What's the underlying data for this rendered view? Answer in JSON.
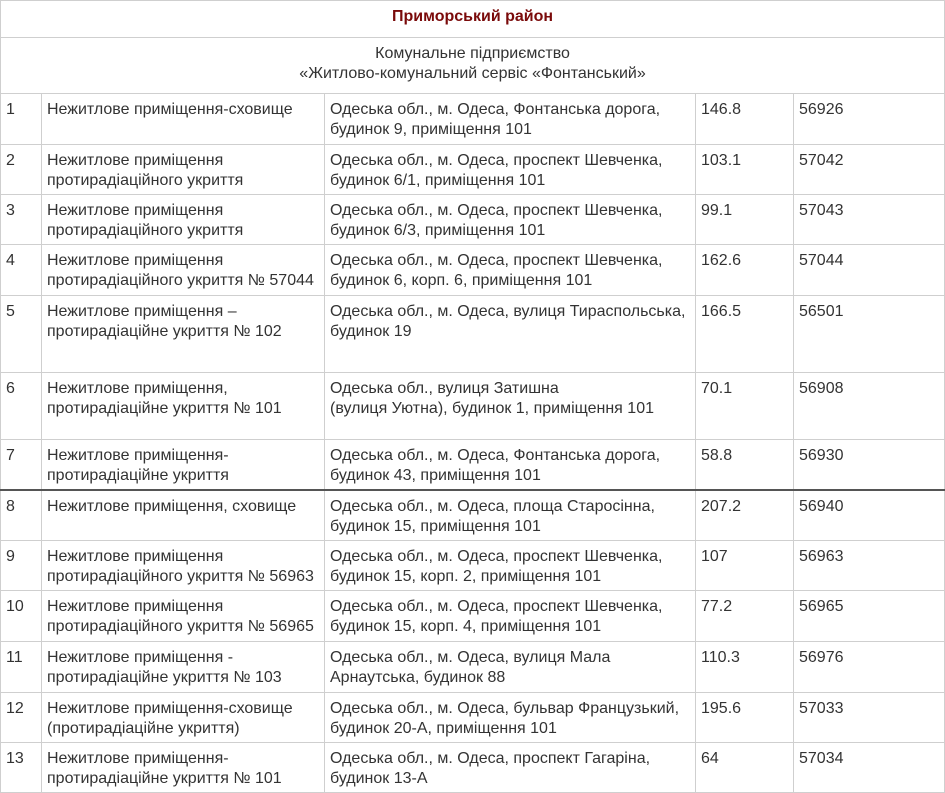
{
  "district": "Приморський район",
  "organization": {
    "line1": "Комунальне підприємство",
    "line2": "«Житлово-комунальний сервіс «Фонтанський»"
  },
  "colors": {
    "district_title": "#7a0a0a",
    "border": "#cfcfcf",
    "text": "#333333"
  },
  "rows": [
    {
      "num": "1",
      "name": [
        "Нежитлове приміщення-сховище"
      ],
      "address": [
        "Одеська обл., м. Одеса, Фонтанська дорога,",
        "будинок 9, приміщення 101"
      ],
      "area": "146.8",
      "code": "56926"
    },
    {
      "num": "2",
      "name": [
        "Нежитлове приміщення",
        "протирадіаційного укриття"
      ],
      "address": [
        "Одеська обл., м. Одеса, проспект Шевченка,",
        "будинок 6/1, приміщення 101"
      ],
      "area": "103.1",
      "code": "57042"
    },
    {
      "num": "3",
      "name": [
        "Нежитлове приміщення",
        "протирадіаційного укриття"
      ],
      "address": [
        "Одеська обл., м. Одеса, проспект Шевченка,",
        "будинок 6/3, приміщення 101"
      ],
      "area": "99.1",
      "code": "57043"
    },
    {
      "num": "4",
      "name": [
        "Нежитлове приміщення",
        "протирадіаційного укриття № 57044"
      ],
      "address": [
        "Одеська обл., м. Одеса, проспект Шевченка,",
        "будинок 6, корп. 6, приміщення 101"
      ],
      "area": "162.6",
      "code": "57044"
    },
    {
      "num": "5",
      "name": [
        "Нежитлове приміщення –",
        "протирадіаційне укриття № 102"
      ],
      "address": [
        "Одеська обл., м. Одеса, вулиця Тираспольська,",
        "будинок 19"
      ],
      "area": "166.5",
      "code": "56501"
    },
    {
      "num": "6",
      "name": [
        "Нежитлове приміщення,",
        "протирадіаційне укриття № 101"
      ],
      "address": [
        "Одеська обл., вулиця Затишна",
        "(вулиця Уютна), будинок 1, приміщення 101"
      ],
      "area": "70.1",
      "code": "56908"
    },
    {
      "num": "7",
      "name": [
        "Нежитлове приміщення-",
        "протирадіаційне укриття"
      ],
      "address": [
        "Одеська обл., м. Одеса, Фонтанська дорога,",
        "будинок 43, приміщення 101"
      ],
      "area": "58.8",
      "code": "56930"
    },
    {
      "num": "8",
      "name": [
        "Нежитлове приміщення, сховище"
      ],
      "address": [
        "Одеська обл., м. Одеса, площа Старосінна,",
        "будинок 15, приміщення 101"
      ],
      "area": "207.2",
      "code": "56940"
    },
    {
      "num": "9",
      "name": [
        "Нежитлове приміщення",
        "протирадіаційного укриття № 56963"
      ],
      "address": [
        "Одеська обл., м. Одеса, проспект Шевченка,",
        "будинок 15, корп. 2, приміщення 101"
      ],
      "area": "107",
      "code": "56963"
    },
    {
      "num": "10",
      "name": [
        "Нежитлове приміщення",
        "протирадіаційного укриття № 56965"
      ],
      "address": [
        "Одеська обл., м. Одеса, проспект Шевченка,",
        "будинок 15, корп. 4, приміщення 101"
      ],
      "area": "77.2",
      "code": "56965"
    },
    {
      "num": "11",
      "name": [
        "Нежитлове приміщення -",
        "протирадіаційне укриття № 103"
      ],
      "address": [
        "Одеська обл., м. Одеса, вулиця Мала",
        "Арнаутська, будинок 88"
      ],
      "area": "110.3",
      "code": "56976"
    },
    {
      "num": "12",
      "name": [
        "Нежитлове приміщення-сховище",
        "(протирадіаційне укриття)"
      ],
      "address": [
        "Одеська обл., м. Одеса, бульвар Французький,",
        "будинок 20-А, приміщення 101"
      ],
      "area": "195.6",
      "code": "57033"
    },
    {
      "num": "13",
      "name": [
        "Нежитлове приміщення-",
        "протирадіаційне укриття № 101"
      ],
      "address": [
        "Одеська обл., м. Одеса, проспект Гагаріна,",
        "будинок 13-А"
      ],
      "area": "64",
      "code": "57034"
    }
  ]
}
